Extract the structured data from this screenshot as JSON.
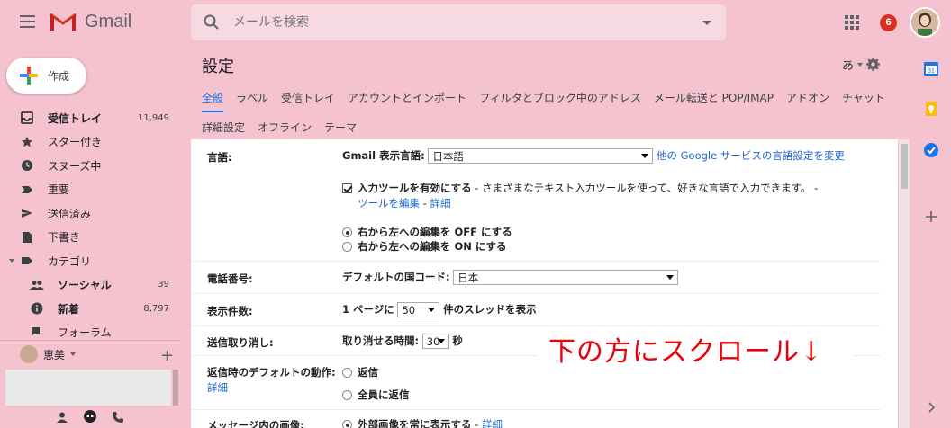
{
  "app": {
    "logo_text": "Gmail",
    "notification_count": "6"
  },
  "search": {
    "placeholder": "メールを検索"
  },
  "compose": {
    "label": "作成"
  },
  "sidebar": {
    "items": [
      {
        "label": "受信トレイ",
        "count": "11,949",
        "bold": true,
        "icon": "inbox-icon"
      },
      {
        "label": "スター付き",
        "count": "",
        "bold": false,
        "icon": "star-icon"
      },
      {
        "label": "スヌーズ中",
        "count": "",
        "bold": false,
        "icon": "clock-icon"
      },
      {
        "label": "重要",
        "count": "",
        "bold": false,
        "icon": "important-icon"
      },
      {
        "label": "送信済み",
        "count": "",
        "bold": false,
        "icon": "send-icon"
      },
      {
        "label": "下書き",
        "count": "",
        "bold": false,
        "icon": "draft-icon"
      },
      {
        "label": "カテゴリ",
        "count": "",
        "bold": false,
        "icon": "label-icon"
      },
      {
        "label": "ソーシャル",
        "count": "39",
        "bold": true,
        "icon": "people-icon"
      },
      {
        "label": "新着",
        "count": "8,797",
        "bold": true,
        "icon": "info-icon"
      },
      {
        "label": "フォーラム",
        "count": "",
        "bold": false,
        "icon": "forum-icon"
      }
    ]
  },
  "hangouts": {
    "user_name": "恵美"
  },
  "main": {
    "title": "設定",
    "lang_indicator": "あ",
    "tabs_row1": [
      "全般",
      "ラベル",
      "受信トレイ",
      "アカウントとインポート",
      "フィルタとブロック中のアドレス",
      "メール転送と POP/IMAP",
      "アドオン",
      "チャット"
    ],
    "tabs_row2": [
      "詳細設定",
      "オフライン",
      "テーマ"
    ]
  },
  "settings": {
    "language": {
      "label": "言語:",
      "display_language_label": "Gmail 表示言語:",
      "display_language_value": "日本語",
      "other_services_link": "他の Google サービスの言語設定を変更",
      "input_tools_label": "入力ツールを有効にする",
      "input_tools_desc": " - さまざまなテキスト入力ツールを使って、好きな言語で入力できます。 -",
      "edit_tools_link": "ツールを編集",
      "separator": " - ",
      "details_link": "詳細",
      "rtl_off": "右から左への編集を OFF にする",
      "rtl_on": "右から左への編集を ON にする"
    },
    "phone": {
      "label": "電話番号:",
      "country_code_label": "デフォルトの国コード:",
      "country_code_value": "日本"
    },
    "page_size": {
      "label": "表示件数:",
      "prefix": "1 ページに",
      "value": "50",
      "suffix": "件のスレッドを表示"
    },
    "undo_send": {
      "label": "送信取り消し:",
      "prefix": "取り消せる時間:",
      "value": "30",
      "suffix": "秒"
    },
    "reply_default": {
      "label": "返信時のデフォルトの動作:",
      "details_link": "詳細",
      "reply": "返信",
      "reply_all": "全員に返信"
    },
    "images": {
      "label": "メッセージ内の画像:",
      "option": "外部画像を常に表示する",
      "separator": " - ",
      "details_link": "詳細"
    }
  },
  "overlay": {
    "text": "下の方にスクロール↓"
  },
  "colors": {
    "background": "#f5c3cf",
    "accent": "#1a73e8",
    "overlay_text": "#e8000b"
  }
}
